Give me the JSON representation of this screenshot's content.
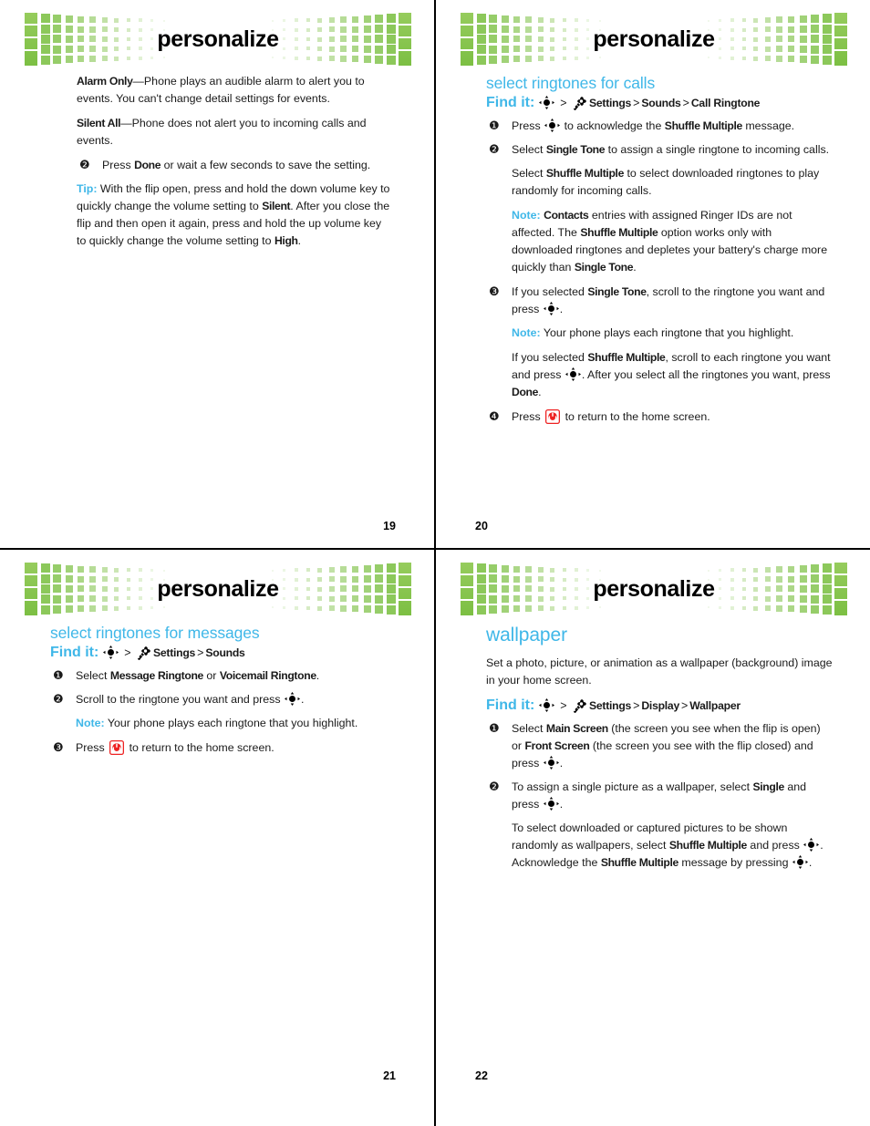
{
  "document": {
    "banner_title": "personalize",
    "brand_green": "#8cc85a",
    "accent_blue": "#3fb7e8",
    "alert_red": "#ee2222"
  },
  "icons": {
    "nav_key": "center-select-navigation-key",
    "settings": "settings-gear-wrench-icon",
    "end_key": "end-call-power-key-icon"
  },
  "pages": [
    {
      "number": "19",
      "number_align": "right",
      "blocks": {
        "alarm_only_term": "Alarm Only",
        "alarm_only_text": "—Phone plays an audible alarm to alert you to events. You can't change detail settings for events.",
        "silent_all_term": "Silent All",
        "silent_all_text": "—Phone does not alert you to incoming calls and events.",
        "step2_num": "❷",
        "step2_pre": "Press ",
        "step2_bold": "Done",
        "step2_post": " or wait a few seconds to save the setting.",
        "tip_label": "Tip:",
        "tip_part1": " With the flip open, press and hold the down volume key to quickly change the volume setting to ",
        "tip_bold1": "Silent",
        "tip_part2": ". After you close the flip and then open it again, press and hold the up volume key to quickly change the volume setting to ",
        "tip_bold2": "High",
        "tip_part3": "."
      }
    },
    {
      "number": "20",
      "number_align": "left",
      "heading": "select ringtones for calls",
      "findit_label": "Find it:",
      "findit_path": [
        "Settings",
        "Sounds",
        "Call Ringtone"
      ],
      "blocks": {
        "step1_num": "❶",
        "step1_pre": "Press ",
        "step1_mid": " to acknowledge the ",
        "step1_bold": "Shuffle Multiple",
        "step1_post": " message.",
        "step2_num": "❷",
        "step2_pre": "Select ",
        "step2_bold": "Single Tone",
        "step2_post": " to assign a single ringtone to incoming calls.",
        "p_shuffle_pre": "Select ",
        "p_shuffle_bold": "Shuffle Multiple",
        "p_shuffle_post": " to select downloaded ringtones to play randomly for incoming calls.",
        "note1_label": "Note:",
        "note1_bold1": "Contacts",
        "note1_t1": " entries with assigned Ringer IDs are not affected. The ",
        "note1_bold2": "Shuffle Multiple",
        "note1_t2": " option works only with downloaded ringtones and depletes your battery's charge more quickly than ",
        "note1_bold3": "Single Tone",
        "note1_t3": ".",
        "step3_num": "❸",
        "step3_pre": "If you selected ",
        "step3_bold": "Single Tone",
        "step3_mid": ", scroll to the ringtone you want and press ",
        "step3_post": ".",
        "note2_label": "Note:",
        "note2_text": " Your phone plays each ringtone that you highlight.",
        "p_shuffle2_pre": "If you selected ",
        "p_shuffle2_bold": "Shuffle Multiple",
        "p_shuffle2_mid": ", scroll to each ringtone you want and press ",
        "p_shuffle2_mid2": ". After you select all the ringtones you want, press ",
        "p_shuffle2_bold2": "Done",
        "p_shuffle2_post": ".",
        "step4_num": "❹",
        "step4_pre": "Press ",
        "step4_post": " to return to the home screen."
      }
    },
    {
      "number": "21",
      "number_align": "right",
      "heading": "select ringtones for messages",
      "findit_label": "Find it:",
      "findit_path": [
        "Settings",
        "Sounds"
      ],
      "blocks": {
        "step1_num": "❶",
        "step1_pre": "Select ",
        "step1_bold1": "Message Ringtone",
        "step1_mid": " or ",
        "step1_bold2": "Voicemail Ringtone",
        "step1_post": ".",
        "step2_num": "❷",
        "step2_pre": "Scroll to the ringtone you want and press ",
        "step2_post": ".",
        "note_label": "Note:",
        "note_text": " Your phone plays each ringtone that you highlight.",
        "step3_num": "❸",
        "step3_pre": "Press ",
        "step3_post": " to return to the home screen."
      }
    },
    {
      "number": "22",
      "number_align": "left",
      "heading": "wallpaper",
      "intro": "Set a photo, picture, or animation as a wallpaper (background) image in your home screen.",
      "findit_label": "Find it:",
      "findit_path": [
        "Settings",
        "Display",
        "Wallpaper"
      ],
      "blocks": {
        "step1_num": "❶",
        "step1_pre": "Select ",
        "step1_bold1": "Main Screen",
        "step1_mid": " (the screen you see when the flip is open) or ",
        "step1_bold2": "Front Screen",
        "step1_mid2": " (the screen you see with the flip closed) and press ",
        "step1_post": ".",
        "step2_num": "❷",
        "step2_pre": "To assign a single picture as a wallpaper, select ",
        "step2_bold": "Single",
        "step2_mid": " and press ",
        "step2_post": ".",
        "p_shuffle_pre": "To select downloaded or captured pictures to be shown randomly as wallpapers, select ",
        "p_shuffle_bold1": "Shuffle Multiple",
        "p_shuffle_mid": " and press ",
        "p_shuffle_mid2": ". Acknowledge the ",
        "p_shuffle_bold2": "Shuffle Multiple",
        "p_shuffle_mid3": " message by pressing ",
        "p_shuffle_post": "."
      }
    }
  ]
}
